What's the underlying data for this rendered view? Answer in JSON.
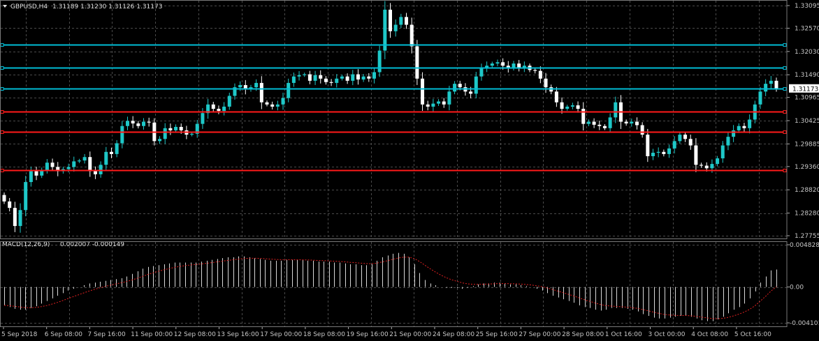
{
  "chart_data": [
    {
      "type": "candlestick",
      "title": "GBPUSD,H4",
      "quote": "1.31189 1.31230 1.31126 1.31173",
      "price_axis_ticks": [
        "1.33095",
        "1.32570",
        "1.32030",
        "1.31490",
        "1.30965",
        "1.30425",
        "1.29885",
        "1.29360",
        "1.28820",
        "1.28280",
        "1.27755"
      ],
      "current_price": "1.31173",
      "ylim": [
        1.27755,
        1.33095
      ],
      "time_axis_labels": [
        "5 Sep 2018",
        "6 Sep 08:00",
        "7 Sep 16:00",
        "11 Sep 00:00",
        "12 Sep 08:00",
        "13 Sep 16:00",
        "17 Sep 00:00",
        "18 Sep 08:00",
        "19 Sep 16:00",
        "21 Sep 00:00",
        "24 Sep 08:00",
        "25 Sep 16:00",
        "27 Sep 00:00",
        "28 Sep 08:00",
        "1 Oct 16:00",
        "3 Oct 00:00",
        "4 Oct 08:00",
        "5 Oct 16:00"
      ],
      "horizontal_levels": [
        {
          "price": 1.3219,
          "color": "#00bcd4"
        },
        {
          "price": 1.3166,
          "color": "#00bcd4"
        },
        {
          "price": 1.3117,
          "color": "#00bcd4"
        },
        {
          "price": 1.3064,
          "color": "#ff1a1a"
        },
        {
          "price": 1.3016,
          "color": "#ff1a1a"
        },
        {
          "price": 1.2928,
          "color": "#ff1a1a"
        }
      ],
      "closes": [
        1.2855,
        1.284,
        1.2798,
        1.2835,
        1.29,
        1.2925,
        1.2915,
        1.2928,
        1.2945,
        1.2935,
        1.2925,
        1.293,
        1.2935,
        1.2948,
        1.295,
        1.2958,
        1.2925,
        1.2918,
        1.294,
        1.297,
        1.2965,
        1.299,
        1.303,
        1.3042,
        1.3036,
        1.303,
        1.304,
        1.3038,
        1.2995,
        1.3,
        1.3025,
        1.302,
        1.3028,
        1.302,
        1.301,
        1.3012,
        1.3035,
        1.306,
        1.308,
        1.307,
        1.3065,
        1.3075,
        1.31,
        1.312,
        1.3125,
        1.3115,
        1.312,
        1.313,
        1.3085,
        1.308,
        1.3075,
        1.308,
        1.3095,
        1.313,
        1.3145,
        1.3148,
        1.315,
        1.3135,
        1.3148,
        1.314,
        1.3132,
        1.313,
        1.314,
        1.3145,
        1.3135,
        1.315,
        1.3138,
        1.3145,
        1.314,
        1.3155,
        1.3205,
        1.33,
        1.325,
        1.3265,
        1.3283,
        1.3265,
        1.3215,
        1.314,
        1.308,
        1.3075,
        1.3082,
        1.3087,
        1.308,
        1.311,
        1.3128,
        1.312,
        1.311,
        1.3105,
        1.3145,
        1.3165,
        1.317,
        1.3175,
        1.3178,
        1.317,
        1.3165,
        1.3175,
        1.3165,
        1.317,
        1.316,
        1.3158,
        1.314,
        1.312,
        1.311,
        1.3085,
        1.307,
        1.3075,
        1.3078,
        1.307,
        1.3035,
        1.304,
        1.3033,
        1.303,
        1.3025,
        1.305,
        1.3085,
        1.304,
        1.3036,
        1.304,
        1.3032,
        1.301,
        1.296,
        1.2968,
        1.297,
        1.2965,
        1.2978,
        1.2995,
        1.301,
        1.3,
        1.2985,
        1.294,
        1.2938,
        1.2932,
        1.2942,
        1.2955,
        1.2985,
        1.3005,
        1.302,
        1.303,
        1.3025,
        1.3045,
        1.308,
        1.311,
        1.3128,
        1.3135,
        1.3117
      ],
      "indicator": {
        "name": "MACD(12,26,9)",
        "quote": "0.002007 -0.000149",
        "axis_ticks": [
          "0.004828",
          "0.00",
          "-0.004101"
        ],
        "ylim": [
          -0.004101,
          0.004828
        ],
        "histogram": [
          -0.0021,
          -0.0023,
          -0.0025,
          -0.0026,
          -0.0026,
          -0.0024,
          -0.0022,
          -0.0019,
          -0.0016,
          -0.0013,
          -0.001,
          -0.0007,
          -0.0004,
          -0.0002,
          0.0,
          0.0002,
          0.0004,
          0.0005,
          0.0006,
          0.0007,
          0.0008,
          0.0009,
          0.001,
          0.0012,
          0.0015,
          0.0018,
          0.0021,
          0.0023,
          0.0024,
          0.0025,
          0.0026,
          0.0027,
          0.0028,
          0.0028,
          0.0028,
          0.0028,
          0.0028,
          0.0029,
          0.003,
          0.0031,
          0.0032,
          0.0033,
          0.0034,
          0.0034,
          0.0035,
          0.0035,
          0.0034,
          0.0033,
          0.0032,
          0.0031,
          0.003,
          0.003,
          0.003,
          0.0031,
          0.0031,
          0.0031,
          0.0031,
          0.003,
          0.003,
          0.0029,
          0.0029,
          0.0029,
          0.0028,
          0.0028,
          0.0027,
          0.0026,
          0.0026,
          0.0025,
          0.0025,
          0.0026,
          0.003,
          0.0034,
          0.0036,
          0.0038,
          0.0039,
          0.0038,
          0.0034,
          0.0026,
          0.0016,
          0.0008,
          0.0004,
          0.0002,
          0.0,
          -0.0001,
          -0.0001,
          -0.0001,
          -0.0002,
          -0.0001,
          0.0001,
          0.0003,
          0.0004,
          0.0004,
          0.0005,
          0.0005,
          0.0004,
          0.0003,
          0.0003,
          0.0002,
          0.0001,
          0.0,
          -0.0002,
          -0.0004,
          -0.0007,
          -0.001,
          -0.0012,
          -0.0014,
          -0.0016,
          -0.0018,
          -0.0021,
          -0.0023,
          -0.0024,
          -0.0026,
          -0.0027,
          -0.0026,
          -0.0024,
          -0.0024,
          -0.0024,
          -0.0025,
          -0.0026,
          -0.0028,
          -0.0031,
          -0.0033,
          -0.0035,
          -0.0036,
          -0.0036,
          -0.0035,
          -0.0034,
          -0.0033,
          -0.0033,
          -0.0034,
          -0.0036,
          -0.0038,
          -0.0039,
          -0.0039,
          -0.0037,
          -0.0034,
          -0.003,
          -0.0026,
          -0.0023,
          -0.0019,
          -0.0013,
          -0.0005,
          0.0005,
          0.0012,
          0.0019,
          0.002
        ]
      }
    }
  ]
}
